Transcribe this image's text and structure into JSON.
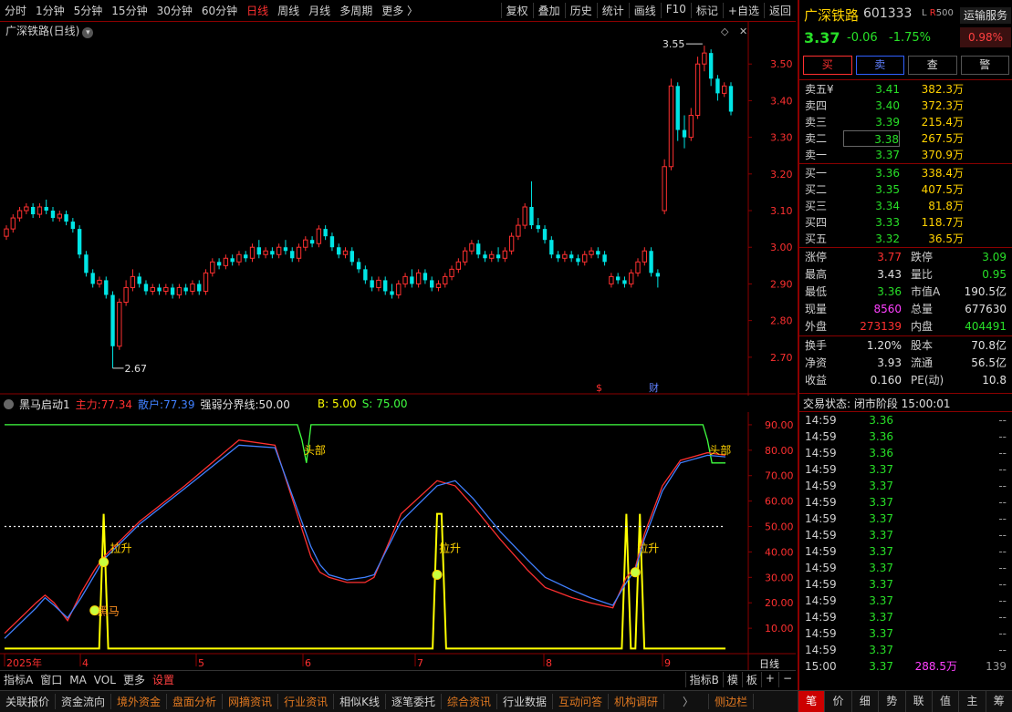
{
  "toolbar": {
    "periods": [
      "分时",
      "1分钟",
      "5分钟",
      "15分钟",
      "30分钟",
      "60分钟",
      "日线",
      "周线",
      "月线",
      "多周期",
      "更多 〉"
    ],
    "active_period": "日线",
    "right_items": [
      "复权",
      "叠加",
      "历史",
      "统计",
      "画线",
      "F10",
      "标记",
      "+自选",
      "返回"
    ]
  },
  "chart": {
    "title": "广深铁路(日线)",
    "high_marker": "3.55",
    "low_marker": "2.67",
    "price_ticks": [
      "3.50",
      "3.40",
      "3.30",
      "3.20",
      "3.10",
      "3.00",
      "2.90",
      "2.80",
      "2.70"
    ],
    "event_marks": [
      "$",
      "财"
    ]
  },
  "chart_data": [
    {
      "type": "candlestick",
      "title": "广深铁路(日线)",
      "yticks": [
        3.5,
        3.4,
        3.3,
        3.2,
        3.1,
        3.0,
        2.9,
        2.8,
        2.7
      ],
      "ylim": [
        2.62,
        3.6
      ],
      "annotations": [
        {
          "text": "3.55",
          "value": 3.55
        },
        {
          "text": "2.67",
          "value": 2.67
        }
      ],
      "candles": [
        [
          3.03,
          3.05,
          3.02,
          3.06
        ],
        [
          3.05,
          3.08,
          3.04,
          3.09
        ],
        [
          3.08,
          3.1,
          3.07,
          3.11
        ],
        [
          3.1,
          3.11,
          3.09,
          3.12
        ],
        [
          3.11,
          3.09,
          3.08,
          3.12
        ],
        [
          3.09,
          3.11,
          3.08,
          3.12
        ],
        [
          3.11,
          3.1,
          3.09,
          3.13
        ],
        [
          3.1,
          3.08,
          3.07,
          3.11
        ],
        [
          3.08,
          3.09,
          3.07,
          3.1
        ],
        [
          3.09,
          3.07,
          3.06,
          3.1
        ],
        [
          3.07,
          3.05,
          3.04,
          3.08
        ],
        [
          3.05,
          2.98,
          2.97,
          3.06
        ],
        [
          2.98,
          2.93,
          2.92,
          2.99
        ],
        [
          2.93,
          2.9,
          2.89,
          2.94
        ],
        [
          2.9,
          2.91,
          2.89,
          2.92
        ],
        [
          2.91,
          2.87,
          2.86,
          2.92
        ],
        [
          2.87,
          2.73,
          2.67,
          2.88
        ],
        [
          2.73,
          2.85,
          2.72,
          2.86
        ],
        [
          2.85,
          2.89,
          2.84,
          2.91
        ],
        [
          2.89,
          2.92,
          2.88,
          2.94
        ],
        [
          2.92,
          2.9,
          2.89,
          2.93
        ],
        [
          2.9,
          2.88,
          2.87,
          2.91
        ],
        [
          2.88,
          2.89,
          2.87,
          2.9
        ],
        [
          2.89,
          2.88,
          2.87,
          2.9
        ],
        [
          2.88,
          2.89,
          2.87,
          2.9
        ],
        [
          2.89,
          2.87,
          2.86,
          2.9
        ],
        [
          2.87,
          2.89,
          2.86,
          2.9
        ],
        [
          2.89,
          2.88,
          2.87,
          2.9
        ],
        [
          2.88,
          2.9,
          2.87,
          2.91
        ],
        [
          2.9,
          2.88,
          2.87,
          2.91
        ],
        [
          2.88,
          2.93,
          2.87,
          2.94
        ],
        [
          2.93,
          2.96,
          2.92,
          2.97
        ],
        [
          2.96,
          2.95,
          2.94,
          2.97
        ],
        [
          2.95,
          2.97,
          2.94,
          2.98
        ],
        [
          2.97,
          2.96,
          2.95,
          2.98
        ],
        [
          2.96,
          2.98,
          2.95,
          2.99
        ],
        [
          2.98,
          2.97,
          2.96,
          2.99
        ],
        [
          2.97,
          3.0,
          2.96,
          3.01
        ],
        [
          3.0,
          2.98,
          2.97,
          3.02
        ],
        [
          2.98,
          2.99,
          2.97,
          3.0
        ],
        [
          2.99,
          2.98,
          2.97,
          3.0
        ],
        [
          2.98,
          3.0,
          2.97,
          3.01
        ],
        [
          3.0,
          2.99,
          2.98,
          3.02
        ],
        [
          2.99,
          2.97,
          2.96,
          3.0
        ],
        [
          2.97,
          3.0,
          2.96,
          3.01
        ],
        [
          3.0,
          3.02,
          2.99,
          3.03
        ],
        [
          3.02,
          3.01,
          3.0,
          3.03
        ],
        [
          3.01,
          3.05,
          3.0,
          3.06
        ],
        [
          3.05,
          3.03,
          3.02,
          3.06
        ],
        [
          3.03,
          3.0,
          2.99,
          3.04
        ],
        [
          3.0,
          2.98,
          2.97,
          3.01
        ],
        [
          2.98,
          2.99,
          2.97,
          3.0
        ],
        [
          2.99,
          2.96,
          2.95,
          3.0
        ],
        [
          2.96,
          2.94,
          2.93,
          2.97
        ],
        [
          2.94,
          2.91,
          2.9,
          2.95
        ],
        [
          2.91,
          2.89,
          2.88,
          2.92
        ],
        [
          2.89,
          2.91,
          2.88,
          2.92
        ],
        [
          2.91,
          2.88,
          2.87,
          2.92
        ],
        [
          2.88,
          2.87,
          2.86,
          2.9
        ],
        [
          2.87,
          2.9,
          2.86,
          2.91
        ],
        [
          2.9,
          2.92,
          2.89,
          2.93
        ],
        [
          2.92,
          2.9,
          2.89,
          2.94
        ],
        [
          2.9,
          2.93,
          2.89,
          2.94
        ],
        [
          2.93,
          2.91,
          2.9,
          2.94
        ],
        [
          2.91,
          2.89,
          2.88,
          2.92
        ],
        [
          2.89,
          2.9,
          2.88,
          2.91
        ],
        [
          2.9,
          2.92,
          2.89,
          2.93
        ],
        [
          2.92,
          2.94,
          2.91,
          2.95
        ],
        [
          2.94,
          2.96,
          2.93,
          2.97
        ],
        [
          2.96,
          2.99,
          2.95,
          3.0
        ],
        [
          2.99,
          3.01,
          2.98,
          3.02
        ],
        [
          3.01,
          2.98,
          2.97,
          3.02
        ],
        [
          2.98,
          2.97,
          2.96,
          2.99
        ],
        [
          2.97,
          2.98,
          2.96,
          2.99
        ],
        [
          2.98,
          2.97,
          2.96,
          3.0
        ],
        [
          2.97,
          2.99,
          2.96,
          3.0
        ],
        [
          2.99,
          3.03,
          2.98,
          3.04
        ],
        [
          3.03,
          3.06,
          3.02,
          3.08
        ],
        [
          3.06,
          3.11,
          3.05,
          3.12
        ],
        [
          3.11,
          3.06,
          3.05,
          3.18
        ],
        [
          3.06,
          3.05,
          3.04,
          3.08
        ],
        [
          3.05,
          3.02,
          3.01,
          3.06
        ],
        [
          3.02,
          2.98,
          2.97,
          3.03
        ],
        [
          2.98,
          2.97,
          2.96,
          2.99
        ],
        [
          2.97,
          2.98,
          2.96,
          2.99
        ],
        [
          2.98,
          2.97,
          2.96,
          2.99
        ],
        [
          2.97,
          2.96,
          2.95,
          2.98
        ],
        [
          2.96,
          2.98,
          2.95,
          2.99
        ],
        [
          2.98,
          2.99,
          2.97,
          3.0
        ],
        [
          2.99,
          2.98,
          2.97,
          3.0
        ],
        [
          2.98,
          2.96,
          2.95,
          2.99
        ],
        [
          2.9,
          2.92,
          2.89,
          2.93
        ],
        [
          2.92,
          2.91,
          2.9,
          2.93
        ],
        [
          2.91,
          2.9,
          2.89,
          2.92
        ],
        [
          2.9,
          2.93,
          2.89,
          2.94
        ],
        [
          2.93,
          2.96,
          2.92,
          2.97
        ],
        [
          2.96,
          2.99,
          2.95,
          3.0
        ],
        [
          2.99,
          2.93,
          2.92,
          3.0
        ],
        [
          2.93,
          2.92,
          2.89,
          2.94
        ],
        [
          3.1,
          3.22,
          3.09,
          3.24
        ],
        [
          3.22,
          3.44,
          3.21,
          3.46
        ],
        [
          3.44,
          3.32,
          3.29,
          3.45
        ],
        [
          3.32,
          3.3,
          3.27,
          3.36
        ],
        [
          3.3,
          3.36,
          3.29,
          3.38
        ],
        [
          3.36,
          3.5,
          3.35,
          3.52
        ],
        [
          3.5,
          3.53,
          3.48,
          3.55
        ],
        [
          3.53,
          3.46,
          3.44,
          3.54
        ],
        [
          3.46,
          3.42,
          3.4,
          3.47
        ],
        [
          3.42,
          3.44,
          3.41,
          3.45
        ],
        [
          3.44,
          3.37,
          3.36,
          3.45
        ]
      ]
    },
    {
      "type": "line",
      "title": "黑马启动1",
      "yticks": [
        90,
        80,
        70,
        60,
        50,
        40,
        30,
        20,
        10
      ],
      "ylim": [
        0,
        95
      ],
      "series": [
        {
          "name": "主力",
          "color": "#ff3030",
          "x": [
            0,
            7,
            9,
            11,
            14,
            17,
            20,
            22,
            30,
            40,
            52,
            60,
            68,
            70,
            72,
            76,
            80,
            82,
            88,
            96,
            100,
            104,
            110,
            116,
            120,
            126,
            130,
            135,
            138,
            140,
            142,
            146,
            150,
            156,
            160
          ],
          "y": [
            8,
            20,
            23,
            20,
            13,
            24,
            33,
            38,
            52,
            66,
            84,
            82,
            38,
            32,
            30,
            28,
            28,
            30,
            55,
            68,
            66,
            58,
            45,
            33,
            26,
            22,
            20,
            18,
            30,
            34,
            47,
            66,
            76,
            79,
            78
          ]
        },
        {
          "name": "散户",
          "color": "#4080ff",
          "x": [
            0,
            7,
            9,
            11,
            14,
            17,
            20,
            22,
            30,
            40,
            52,
            60,
            68,
            70,
            72,
            76,
            80,
            82,
            88,
            96,
            100,
            104,
            110,
            116,
            120,
            126,
            130,
            135,
            138,
            140,
            142,
            146,
            150,
            156,
            160
          ],
          "y": [
            6,
            18,
            22,
            19,
            14,
            22,
            31,
            37,
            51,
            65,
            82,
            81,
            42,
            35,
            31,
            29,
            30,
            31,
            52,
            66,
            68,
            61,
            48,
            37,
            30,
            25,
            22,
            19,
            28,
            33,
            45,
            64,
            75,
            78,
            77.4
          ]
        },
        {
          "name": "强弱分界线",
          "color": "#ffffff",
          "x": [
            0,
            160
          ],
          "y": [
            50,
            50
          ]
        },
        {
          "name": "B",
          "color": "#ffff00",
          "x": [
            0,
            21,
            22,
            23,
            95,
            96,
            97,
            98,
            137,
            138,
            139,
            140,
            141,
            142,
            143,
            160
          ],
          "y": [
            2,
            2,
            55,
            2,
            2,
            55,
            55,
            2,
            2,
            55,
            2,
            2,
            55,
            2,
            2,
            2
          ]
        },
        {
          "name": "S",
          "color": "#40ff40",
          "x": [
            0,
            65,
            66,
            67,
            68,
            155,
            156,
            157,
            158,
            160
          ],
          "y": [
            90,
            90,
            84,
            75,
            90,
            90,
            84,
            75,
            75,
            75
          ]
        }
      ],
      "annotations": [
        "黑马",
        "拉升",
        "拉升",
        "拉升",
        "头部",
        "头部"
      ],
      "xticks": [
        "2025年",
        "4",
        "5",
        "6",
        "7",
        "8",
        "9"
      ]
    }
  ],
  "indicator": {
    "name": "黑马启动1",
    "main_label": "主力:",
    "main_value": "77.34",
    "retail_label": "散户:",
    "retail_value": "77.39",
    "line_label": "强弱分界线:",
    "line_value": "50.00",
    "b_label": "B:",
    "b_value": "5.00",
    "s_label": "S:",
    "s_value": "75.00",
    "ticks": [
      "90.00",
      "80.00",
      "70.00",
      "60.00",
      "50.00",
      "40.00",
      "30.00",
      "20.00",
      "10.00"
    ],
    "annotations": {
      "heima": "黑马",
      "lasheng": "拉升",
      "toubu": "头部"
    },
    "x_labels": [
      "2025年",
      "4",
      "5",
      "6",
      "7",
      "8",
      "9"
    ],
    "period_label": "日线"
  },
  "bottom_tabs": {
    "left": [
      "指标A",
      "窗口",
      "MA",
      "VOL",
      "更多"
    ],
    "settings": "设置",
    "right": [
      "指标B",
      "模",
      "板",
      "+",
      "−"
    ]
  },
  "statusbar": {
    "items": [
      "关联报价",
      "资金流向",
      "境外资金",
      "盘面分析",
      "网摘资讯",
      "行业资讯",
      "相似K线",
      "逐笔委托",
      "综合资讯",
      "行业数据",
      "互动问答",
      "机构调研"
    ],
    "highlighted": [
      "境外资金",
      "盘面分析",
      "网摘资讯",
      "行业资讯",
      "综合资讯",
      "互动问答",
      "机构调研"
    ],
    "arrow": "〉",
    "sidebar": "侧边栏"
  },
  "right_tabs": [
    "笔",
    "价",
    "细",
    "势",
    "联",
    "值",
    "主",
    "筹"
  ],
  "stock": {
    "name": "广深铁路",
    "code": "601333",
    "lr_l": "L",
    "lr_r": "R",
    "lr_num": "500",
    "price": "3.37",
    "change": "-0.06",
    "change_pct": "-1.75%",
    "sector": "运输服务",
    "sector_pct": "0.98%"
  },
  "actions": [
    "买",
    "卖",
    "查",
    "警"
  ],
  "order_book": {
    "sells": [
      {
        "label": "卖五",
        "mark": "¥",
        "price": "3.41",
        "vol": "382.3万"
      },
      {
        "label": "卖四",
        "mark": "",
        "price": "3.40",
        "vol": "372.3万"
      },
      {
        "label": "卖三",
        "mark": "",
        "price": "3.39",
        "vol": "215.4万"
      },
      {
        "label": "卖二",
        "mark": "",
        "price": "3.38",
        "vol": "267.5万"
      },
      {
        "label": "卖一",
        "mark": "",
        "price": "3.37",
        "vol": "370.9万"
      }
    ],
    "buys": [
      {
        "label": "买一",
        "price": "3.36",
        "vol": "338.4万"
      },
      {
        "label": "买二",
        "price": "3.35",
        "vol": "407.5万"
      },
      {
        "label": "买三",
        "price": "3.34",
        "vol": "81.8万"
      },
      {
        "label": "买四",
        "price": "3.33",
        "vol": "118.7万"
      },
      {
        "label": "买五",
        "price": "3.32",
        "vol": "36.5万"
      }
    ]
  },
  "stats": [
    {
      "l1": "涨停",
      "v1": "3.77",
      "c1": "red",
      "l2": "跌停",
      "v2": "3.09",
      "c2": "green"
    },
    {
      "l1": "最高",
      "v1": "3.43",
      "c1": "white",
      "l2": "量比",
      "v2": "0.95",
      "c2": "green"
    },
    {
      "l1": "最低",
      "v1": "3.36",
      "c1": "green",
      "l2": "市值A",
      "v2": "190.5亿",
      "c2": "white"
    },
    {
      "l1": "现量",
      "v1": "8560",
      "c1": "mag",
      "l2": "总量",
      "v2": "677630",
      "c2": "white"
    },
    {
      "l1": "外盘",
      "v1": "273139",
      "c1": "red",
      "l2": "内盘",
      "v2": "404491",
      "c2": "green"
    },
    {
      "l1": "换手",
      "v1": "1.20%",
      "c1": "white",
      "l2": "股本",
      "v2": "70.8亿",
      "c2": "white"
    },
    {
      "l1": "净资",
      "v1": "3.93",
      "c1": "white",
      "l2": "流通",
      "v2": "56.5亿",
      "c2": "white"
    },
    {
      "l1": "收益",
      "v1": "0.160",
      "c1": "white",
      "l2": "PE(动)",
      "v2": "10.8",
      "c2": "white"
    }
  ],
  "trade_status": "交易状态: 闭市阶段 15:00:01",
  "ticks": [
    {
      "t": "14:59",
      "p": "3.36",
      "v": "",
      "n": "--"
    },
    {
      "t": "14:59",
      "p": "3.36",
      "v": "",
      "n": "--"
    },
    {
      "t": "14:59",
      "p": "3.36",
      "v": "",
      "n": "--"
    },
    {
      "t": "14:59",
      "p": "3.37",
      "v": "",
      "n": "--"
    },
    {
      "t": "14:59",
      "p": "3.37",
      "v": "",
      "n": "--"
    },
    {
      "t": "14:59",
      "p": "3.37",
      "v": "",
      "n": "--"
    },
    {
      "t": "14:59",
      "p": "3.37",
      "v": "",
      "n": "--"
    },
    {
      "t": "14:59",
      "p": "3.37",
      "v": "",
      "n": "--"
    },
    {
      "t": "14:59",
      "p": "3.37",
      "v": "",
      "n": "--"
    },
    {
      "t": "14:59",
      "p": "3.37",
      "v": "",
      "n": "--"
    },
    {
      "t": "14:59",
      "p": "3.37",
      "v": "",
      "n": "--"
    },
    {
      "t": "14:59",
      "p": "3.37",
      "v": "",
      "n": "--"
    },
    {
      "t": "14:59",
      "p": "3.37",
      "v": "",
      "n": "--"
    },
    {
      "t": "14:59",
      "p": "3.37",
      "v": "",
      "n": "--"
    },
    {
      "t": "14:59",
      "p": "3.37",
      "v": "",
      "n": "--"
    },
    {
      "t": "15:00",
      "p": "3.37",
      "v": "288.5万",
      "n": "139"
    }
  ]
}
